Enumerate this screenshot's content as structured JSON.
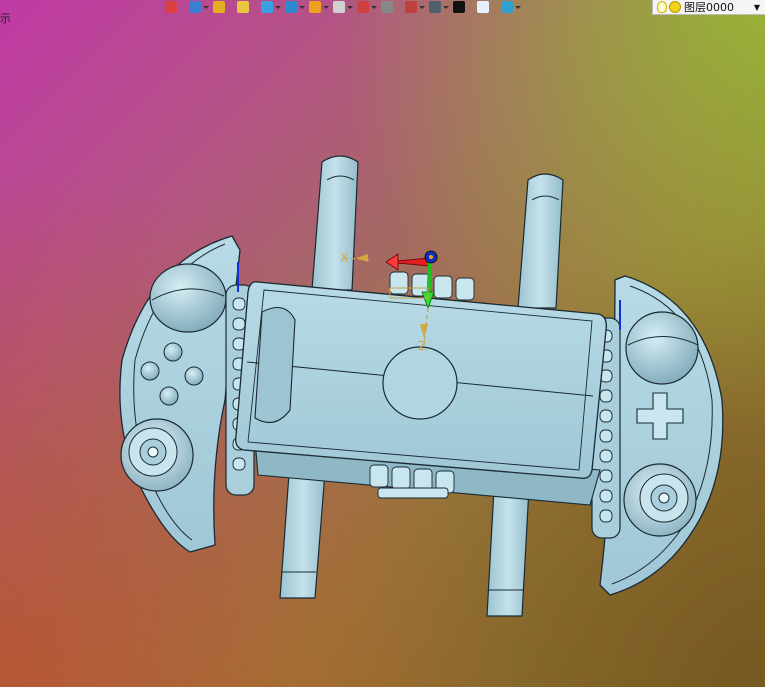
{
  "toolbar": {
    "buttons": [
      {
        "name": "import-icon",
        "color": "#d94040",
        "has_menu": false
      },
      {
        "name": "snap-icon",
        "color": "#3a7fd0",
        "has_menu": true
      },
      {
        "name": "pencil-icon",
        "color": "#e0b020",
        "has_menu": false
      },
      {
        "name": "box-layer-icon",
        "color": "#e8c640",
        "has_menu": false
      },
      {
        "name": "solid-box-icon",
        "color": "#3aa0e0",
        "has_menu": true
      },
      {
        "name": "extrude-icon",
        "color": "#2d8ad0",
        "has_menu": true
      },
      {
        "name": "render-ball-icon",
        "color": "#f0a020",
        "has_menu": true
      },
      {
        "name": "zoom-icon",
        "color": "#d0d0d0",
        "has_menu": true
      },
      {
        "name": "move-axis-icon",
        "color": "#d04040",
        "has_menu": true
      },
      {
        "name": "view-icon",
        "color": "#888888",
        "has_menu": false
      },
      {
        "name": "frame-icon",
        "color": "#c04040",
        "has_menu": true
      },
      {
        "name": "monitor-icon",
        "color": "#506070",
        "has_menu": true
      },
      {
        "name": "line-icon",
        "color": "#111111",
        "has_menu": false
      },
      {
        "name": "sheet-icon",
        "color": "#e8f0ff",
        "has_menu": false
      },
      {
        "name": "layers-icon",
        "color": "#30a0d0",
        "has_menu": true
      }
    ]
  },
  "layer": {
    "name": "图层0000"
  },
  "edge_text": "示",
  "gizmo": {
    "x_label": "X",
    "z_label": "Z"
  }
}
